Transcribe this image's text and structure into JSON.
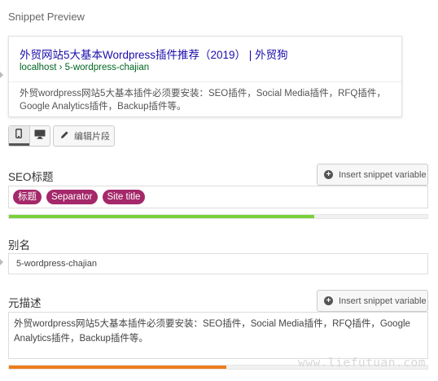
{
  "snippet": {
    "heading": "Snippet Preview",
    "title": "外贸网站5大基本Wordpress插件推荐（2019） | 外贸狗",
    "url": "localhost › 5-wordpress-chajian",
    "description": "外贸wordpress网站5大基本插件必须要安装：SEO插件，Social Media插件，RFQ插件，Google Analytics插件，Backup插件等。"
  },
  "toolbar": {
    "mobile_icon": "mobile-icon",
    "desktop_icon": "desktop-icon",
    "edit_icon": "pencil-icon",
    "edit_label": "编辑片段"
  },
  "seo_title": {
    "label": "SEO标题",
    "insert_label": "Insert snippet variable",
    "variables": [
      "标题",
      "Separator",
      "Site title"
    ],
    "progress": 0.73,
    "progress_color": "#7ad03a"
  },
  "slug": {
    "label": "别名",
    "value": "5-wordpress-chajian"
  },
  "meta": {
    "label": "元描述",
    "insert_label": "Insert snippet variable",
    "value": "外贸wordpress网站5大基本插件必须要安装：SEO插件，Social Media插件，RFQ插件，Google Analytics插件，Backup插件等。",
    "progress": 0.52,
    "progress_color": "#ee7c1b"
  },
  "colors": {
    "pill": "#a4286a",
    "link": "#1a0dab",
    "url": "#006621"
  },
  "watermark": "www.liefutuan.com"
}
